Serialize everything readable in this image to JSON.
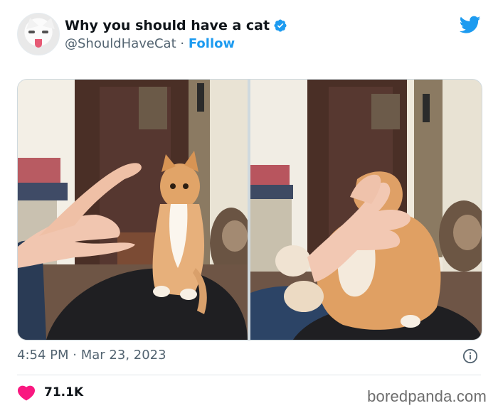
{
  "tweet": {
    "display_name": "Why you should have a cat",
    "handle": "@ShouldHaveCat",
    "separator": "·",
    "follow_label": "Follow",
    "time": "4:54 PM",
    "date": "Mar 23, 2023",
    "likes": "71.1K"
  },
  "icons": {
    "verified": "verified-badge-icon",
    "bird": "twitter-bird-icon",
    "info": "info-icon",
    "heart": "heart-icon"
  },
  "colors": {
    "accent": "#1d9bf0",
    "heart": "#f91880",
    "text_secondary": "#536471"
  },
  "watermark": "boredpanda.com"
}
